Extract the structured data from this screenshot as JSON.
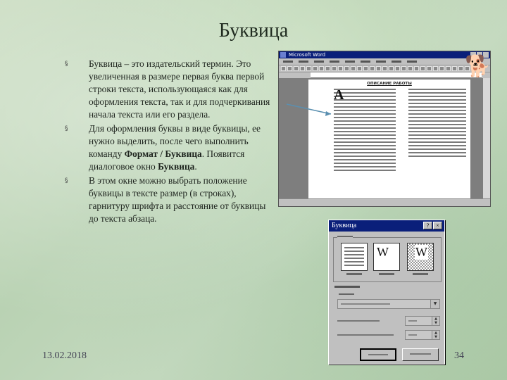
{
  "slide": {
    "title": "Буквица",
    "bullets": [
      {
        "text": "Буквица – это издательский термин. Это увеличенная в размере первая буква первой строки текста, использующаяся как для оформления текста, так и для подчеркивания начала текста или его раздела."
      },
      {
        "text_before": "Для оформления буквы в виде буквицы, ее нужно выделить, после чего выполнить команду ",
        "bold_command": "Формат / Буквица",
        "text_mid": ". Появится диалоговое окно ",
        "bold_dialog": "Буквица",
        "text_after": "."
      },
      {
        "text": "В этом окне можно выбрать положение буквицы в тексте размер (в строках), гарнитуру шрифта и расстояние от буквицы до текста абзаца."
      }
    ],
    "date": "13.02.2018",
    "page_number": "34"
  },
  "word_window": {
    "title": "Microsoft Word",
    "doc_heading": "ОПИСАНИЕ РАБОТЫ",
    "drop_cap_letter": "А"
  },
  "dialog": {
    "title": "Буквица",
    "help_label": "?",
    "close_label": "×",
    "letter": "W",
    "colors": {
      "titlebar": "#0a1f7a",
      "face": "#c0c0c0"
    }
  },
  "icons": [
    "office-assistant-icon",
    "chevron-down-icon",
    "spin-arrows-icon"
  ]
}
